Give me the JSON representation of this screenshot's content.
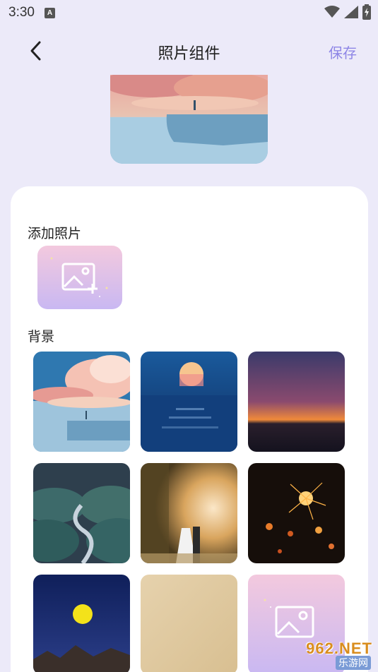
{
  "status_bar": {
    "time": "3:30",
    "notification_letter": "A"
  },
  "header": {
    "title": "照片组件",
    "save_label": "保存"
  },
  "add_section": {
    "label": "添加照片"
  },
  "background_section": {
    "label": "背景",
    "tiles": [
      "sunset-clouds-figure",
      "sun-over-ocean",
      "dusk-sea-horizon",
      "night-hills-river",
      "wedding-couple-forest",
      "sparkler-bokeh",
      "moon-mountains",
      "beige-texture",
      "add-photo-placeholder"
    ]
  },
  "watermark": {
    "brand": "962.NET",
    "sub": "乐游网"
  },
  "colors": {
    "accent": "#8e86e6",
    "page_bg": "#eceaf9",
    "panel_bg": "#ffffff"
  }
}
